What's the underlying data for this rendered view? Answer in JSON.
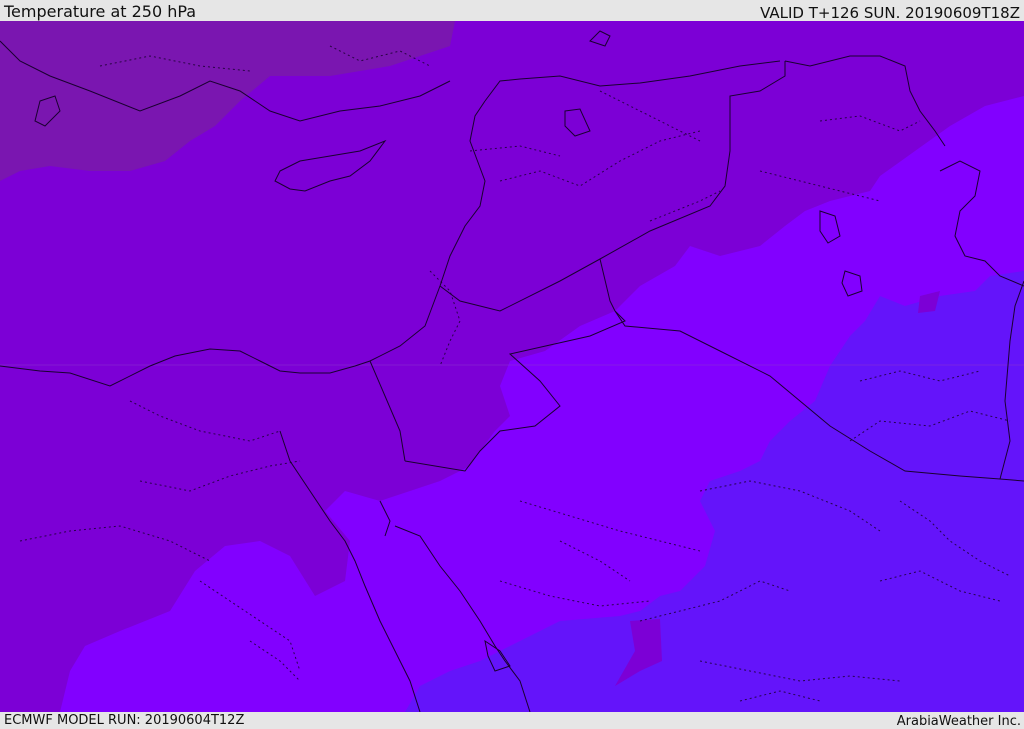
{
  "header": {
    "title": "Temperature at 250 hPa",
    "valid_time": "VALID T+126 SUN. 20190609T18Z"
  },
  "footer": {
    "model_run": "ECMWF MODEL RUN: 20190604T12Z",
    "credit": "ArabiaWeather Inc."
  },
  "map": {
    "field": "temperature",
    "level": "250 hPa",
    "colors": {
      "warmest_fill": "#7a16b0",
      "warm_fill": "#7c00d6",
      "mid_fill": "#8200ff",
      "cool_fill": "#6414fa",
      "border_line": "#1a0030"
    }
  }
}
